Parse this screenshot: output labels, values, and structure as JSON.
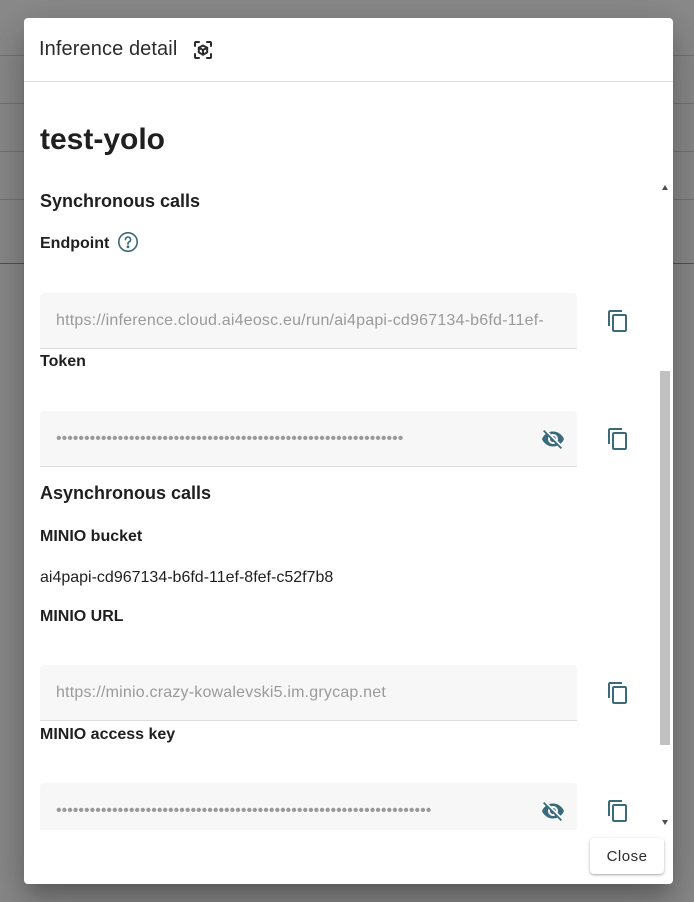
{
  "colors": {
    "accent_icon": "#3b6a7a",
    "field_background": "#f7f7f7",
    "scrollbar_thumb": "#c1c1c1"
  },
  "dialog": {
    "title": "Inference detail",
    "title_icon": "cube-scan-icon",
    "close_label": "Close"
  },
  "model": {
    "name": "test-yolo"
  },
  "sync": {
    "section_title": "Synchronous calls",
    "endpoint": {
      "label": "Endpoint",
      "help_icon": "help-circle-icon",
      "value": "https://inference.cloud.ai4eosc.eu/run/ai4papi-cd967134-b6fd-11ef-",
      "copy_icon": "copy-icon"
    },
    "token": {
      "label": "Token",
      "masked_value": "••••••••••••••••••••••••••••••••••••••••••••••••••••••••••••••",
      "visibility_icon": "eye-off-icon",
      "copy_icon": "copy-icon"
    }
  },
  "async": {
    "section_title": "Asynchronous calls",
    "bucket": {
      "label": "MINIO bucket",
      "value": "ai4papi-cd967134-b6fd-11ef-8fef-c52f7b8"
    },
    "url": {
      "label": "MINIO URL",
      "value": "https://minio.crazy-kowalevski5.im.grycap.net",
      "copy_icon": "copy-icon"
    },
    "access_key": {
      "label": "MINIO access key",
      "masked_value": "•••••••••••••••••••••••••••••••••••••••••••••••••••••••••••••••••••",
      "visibility_icon": "eye-off-icon",
      "copy_icon": "copy-icon"
    }
  }
}
